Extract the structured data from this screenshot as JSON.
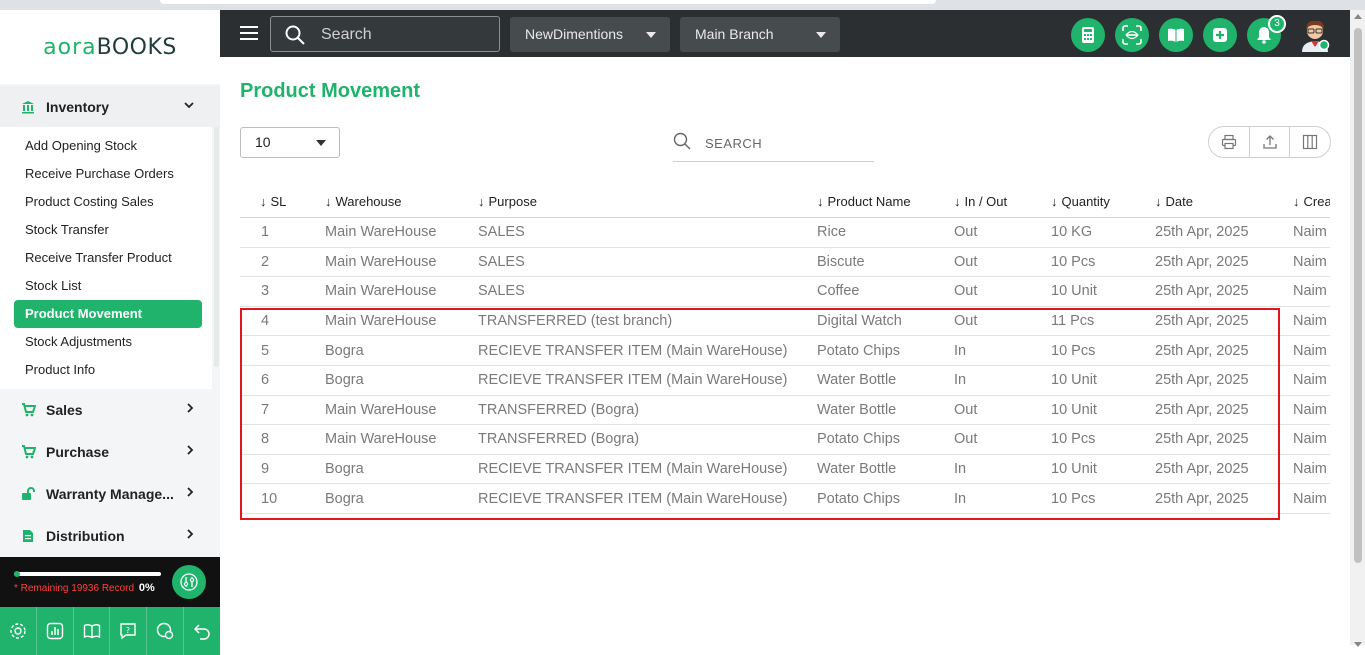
{
  "logo": {
    "part1": "aora",
    "part2": "BOOKS"
  },
  "header": {
    "search_placeholder": "Search",
    "company": "NewDimentions",
    "branch": "Main Branch",
    "notification_count": "3",
    "accent_color": "#1fb36b"
  },
  "sidebar": {
    "inventory_label": "Inventory",
    "inventory_items": [
      {
        "label": "Add Opening Stock"
      },
      {
        "label": "Receive Purchase Orders"
      },
      {
        "label": "Product Costing Sales"
      },
      {
        "label": "Stock Transfer"
      },
      {
        "label": "Receive Transfer Product"
      },
      {
        "label": "Stock List"
      },
      {
        "label": "Product Movement",
        "active": true
      },
      {
        "label": "Stock Adjustments"
      },
      {
        "label": "Product Info"
      }
    ],
    "sections": [
      {
        "label": "Sales",
        "icon": "cart-icon"
      },
      {
        "label": "Purchase",
        "icon": "cart-icon"
      },
      {
        "label": "Warranty Manage...",
        "icon": "unlock-icon"
      },
      {
        "label": "Distribution",
        "icon": "document-icon"
      }
    ],
    "quota": {
      "remaining_text": "* Remaining 19936 Record",
      "percent": "0%",
      "progress": 0.0
    },
    "bottom_tools": [
      "gear-icon",
      "chart-icon",
      "book-icon",
      "help-icon",
      "chat-icon",
      "undo-icon"
    ]
  },
  "main": {
    "title": "Product Movement",
    "per_page": "10",
    "search_placeholder": "SEARCH",
    "columns": [
      "SL",
      "Warehouse",
      "Purpose",
      "Product Name",
      "In / Out",
      "Quantity",
      "Date",
      "Crea"
    ],
    "rows": [
      [
        "1",
        "Main WareHouse",
        "SALES",
        "Rice",
        "Out",
        "10 KG",
        "25th Apr, 2025",
        "Naim"
      ],
      [
        "2",
        "Main WareHouse",
        "SALES",
        "Biscute",
        "Out",
        "10 Pcs",
        "25th Apr, 2025",
        "Naim"
      ],
      [
        "3",
        "Main WareHouse",
        "SALES",
        "Coffee",
        "Out",
        "10 Unit",
        "25th Apr, 2025",
        "Naim"
      ],
      [
        "4",
        "Main WareHouse",
        "TRANSFERRED (test branch)",
        "Digital Watch",
        "Out",
        "11 Pcs",
        "25th Apr, 2025",
        "Naim"
      ],
      [
        "5",
        "Bogra",
        "RECIEVE TRANSFER ITEM (Main WareHouse)",
        "Potato Chips",
        "In",
        "10 Pcs",
        "25th Apr, 2025",
        "Naim"
      ],
      [
        "6",
        "Bogra",
        "RECIEVE TRANSFER ITEM (Main WareHouse)",
        "Water Bottle",
        "In",
        "10 Unit",
        "25th Apr, 2025",
        "Naim"
      ],
      [
        "7",
        "Main WareHouse",
        "TRANSFERRED (Bogra)",
        "Water Bottle",
        "Out",
        "10 Unit",
        "25th Apr, 2025",
        "Naim"
      ],
      [
        "8",
        "Main WareHouse",
        "TRANSFERRED (Bogra)",
        "Potato Chips",
        "Out",
        "10 Pcs",
        "25th Apr, 2025",
        "Naim"
      ],
      [
        "9",
        "Bogra",
        "RECIEVE TRANSFER ITEM (Main WareHouse)",
        "Water Bottle",
        "In",
        "10 Unit",
        "25th Apr, 2025",
        "Naim"
      ],
      [
        "10",
        "Bogra",
        "RECIEVE TRANSFER ITEM (Main WareHouse)",
        "Potato Chips",
        "In",
        "10 Pcs",
        "25th Apr, 2025",
        "Naim"
      ]
    ],
    "highlight_color": "#e0161c"
  }
}
